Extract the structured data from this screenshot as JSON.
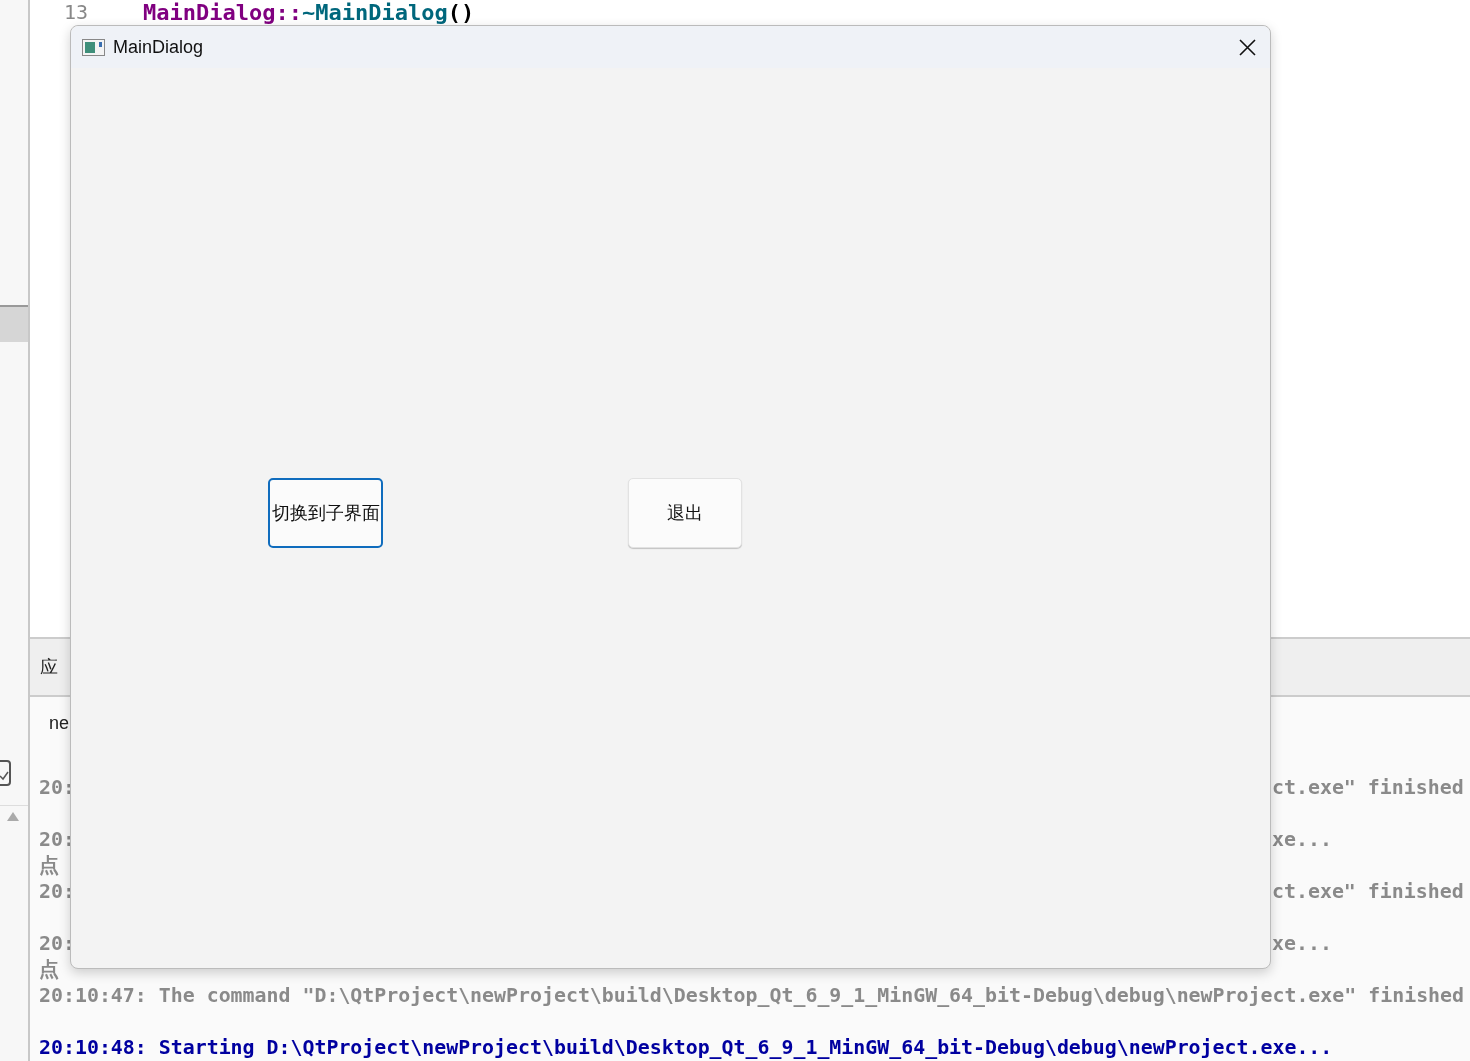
{
  "editor": {
    "line_number": "13",
    "code": [
      {
        "text": "MainDialog::",
        "color": "#800080"
      },
      {
        "text": "~MainDialog",
        "color": "#00677c"
      },
      {
        "text": "()",
        "color": "#000000"
      }
    ]
  },
  "output_pane": {
    "tab_label": "应",
    "row_label": "ne",
    "lines": [
      {
        "kind": "split",
        "left": "20:",
        "right": "ct.exe\" finished",
        "highlight": false
      },
      {
        "kind": "split",
        "left": "20:",
        "right": "xe...",
        "highlight": false
      },
      {
        "kind": "split",
        "left": "点",
        "highlight": false
      },
      {
        "kind": "split",
        "left": "20:",
        "right": "ct.exe\" finished",
        "highlight": false
      },
      {
        "kind": "split",
        "left": "20:",
        "right": "xe...",
        "highlight": false
      },
      {
        "kind": "split",
        "left": "点",
        "highlight": false
      },
      {
        "kind": "full",
        "text": "20:10:47: The command \"D:\\QtProject\\newProject\\build\\Desktop_Qt_6_9_1_MinGW_64_bit-Debug\\debug\\newProject.exe\" finished",
        "highlight": false
      },
      {
        "kind": "full",
        "text": "20:10:48: Starting D:\\QtProject\\newProject\\build\\Desktop_Qt_6_9_1_MinGW_64_bit-Debug\\debug\\newProject.exe...",
        "highlight": true
      }
    ]
  },
  "dialog": {
    "title": "MainDialog",
    "buttons": [
      {
        "label": "切换到子界面",
        "focused": true
      },
      {
        "label": "退出",
        "focused": false
      }
    ]
  }
}
